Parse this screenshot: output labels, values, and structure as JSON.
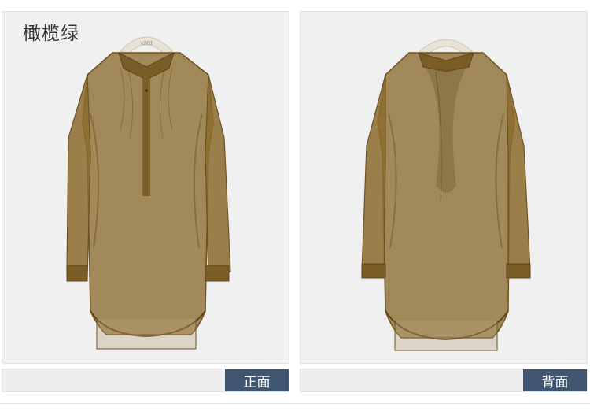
{
  "color_name": "橄榄绿",
  "views": [
    {
      "label": "正面"
    },
    {
      "label": "背面"
    }
  ],
  "hanger_brand": "AMII",
  "colors": {
    "fabric": "#8c6b2e",
    "fabric_dark": "#6d5221",
    "tag_bg": "#3f5570"
  }
}
